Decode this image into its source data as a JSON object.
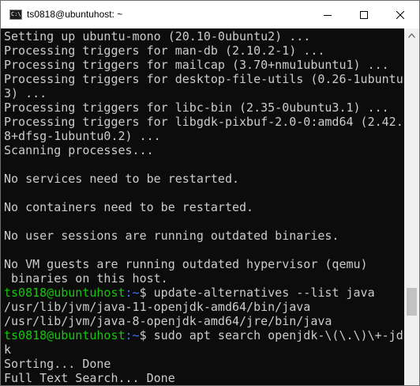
{
  "window": {
    "title": "ts0818@ubuntuhost: ~",
    "app_icon_text": "C:\\"
  },
  "controls": {
    "minimize": "minimize",
    "maximize": "maximize",
    "close": "close"
  },
  "terminal": {
    "lines": [
      "Setting up ubuntu-mono (20.10-0ubuntu2) ...",
      "Processing triggers for man-db (2.10.2-1) ...",
      "Processing triggers for mailcap (3.70+nmu1ubuntu1) ...",
      "Processing triggers for desktop-file-utils (0.26-1ubuntu",
      "3) ...",
      "Processing triggers for libc-bin (2.35-0ubuntu3.1) ...",
      "Processing triggers for libgdk-pixbuf-2.0-0:amd64 (2.42.",
      "8+dfsg-1ubuntu0.2) ...",
      "Scanning processes...",
      "",
      "No services need to be restarted.",
      "",
      "No containers need to be restarted.",
      "",
      "No user sessions are running outdated binaries.",
      "",
      "No VM guests are running outdated hypervisor (qemu)",
      " binaries on this host."
    ],
    "prompt": {
      "user_host": "ts0818@ubuntuhost",
      "path": ":~",
      "symbol": "$ "
    },
    "command_1": "update-alternatives --list java",
    "output_1": [
      "/usr/lib/jvm/java-11-openjdk-amd64/bin/java",
      "/usr/lib/jvm/java-8-openjdk-amd64/jre/bin/java"
    ],
    "command_2": "sudo apt search openjdk-\\(\\.\\)\\+-jd",
    "command_2_wrap": "k",
    "output_2": [
      "Sorting... Done",
      "Full Text Search... Done"
    ]
  },
  "colors": {
    "console_bg": "#0c0c0c",
    "console_text": "#cccccc",
    "prompt_user": "#16c60c",
    "prompt_path": "#3b78ff"
  }
}
